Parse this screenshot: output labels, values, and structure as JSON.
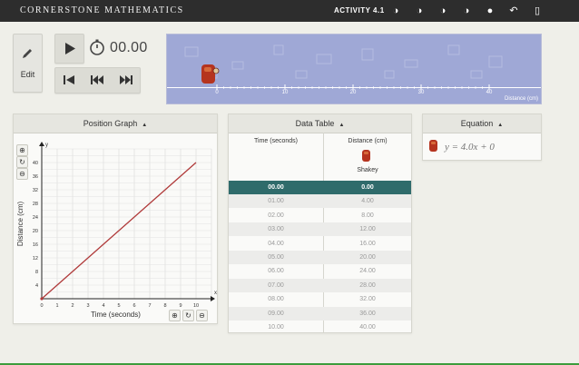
{
  "topbar": {
    "brand": "CORNERSTONE MATHEMATICS",
    "activity": "ACTIVITY 4.1",
    "icons": [
      "contrast-1-icon",
      "contrast-2-icon",
      "contrast-3-icon",
      "contrast-4-icon",
      "info-icon",
      "back-icon",
      "exit-icon"
    ]
  },
  "controls": {
    "edit_label": "Edit",
    "timer_value": "00.00"
  },
  "strip": {
    "ticks": [
      "0",
      "10",
      "20",
      "30",
      "40"
    ],
    "unit": "Distance (cm)"
  },
  "graph": {
    "title": "Position Graph",
    "xlabel": "Time (seconds)",
    "ylabel": "Distance (cm)",
    "x_axis_symbol": "x",
    "y_axis_symbol": "y",
    "x_ticks": [
      "0",
      "1",
      "2",
      "3",
      "4",
      "5",
      "6",
      "7",
      "8",
      "9",
      "10"
    ],
    "y_ticks": [
      "4",
      "8",
      "12",
      "16",
      "20",
      "24",
      "28",
      "32",
      "36",
      "40"
    ]
  },
  "chart_data": {
    "type": "line",
    "x": [
      0,
      10
    ],
    "series": [
      {
        "values": [
          0,
          40
        ]
      }
    ],
    "xlabel": "Time (seconds)",
    "ylabel": "Distance (cm)",
    "xlim": [
      0,
      11
    ],
    "ylim": [
      0,
      44
    ],
    "grid": true,
    "color": "#b03a3a"
  },
  "table": {
    "title": "Data Table",
    "col_time": "Time (seconds)",
    "col_distance": "Distance (cm)",
    "series_name": "Shakey",
    "rows": [
      {
        "t": "00.00",
        "d": "0.00"
      },
      {
        "t": "01.00",
        "d": "4.00"
      },
      {
        "t": "02.00",
        "d": "8.00"
      },
      {
        "t": "03.00",
        "d": "12.00"
      },
      {
        "t": "04.00",
        "d": "16.00"
      },
      {
        "t": "05.00",
        "d": "20.00"
      },
      {
        "t": "06.00",
        "d": "24.00"
      },
      {
        "t": "07.00",
        "d": "28.00"
      },
      {
        "t": "08.00",
        "d": "32.00"
      },
      {
        "t": "09.00",
        "d": "36.00"
      },
      {
        "t": "10.00",
        "d": "40.00"
      }
    ],
    "selected_row": 0
  },
  "equation": {
    "title": "Equation",
    "text": "y = 4.0x + 0"
  },
  "colors": {
    "accent": "#2f6b6b",
    "line": "#b03a3a",
    "strip": "#9fa8d6"
  }
}
